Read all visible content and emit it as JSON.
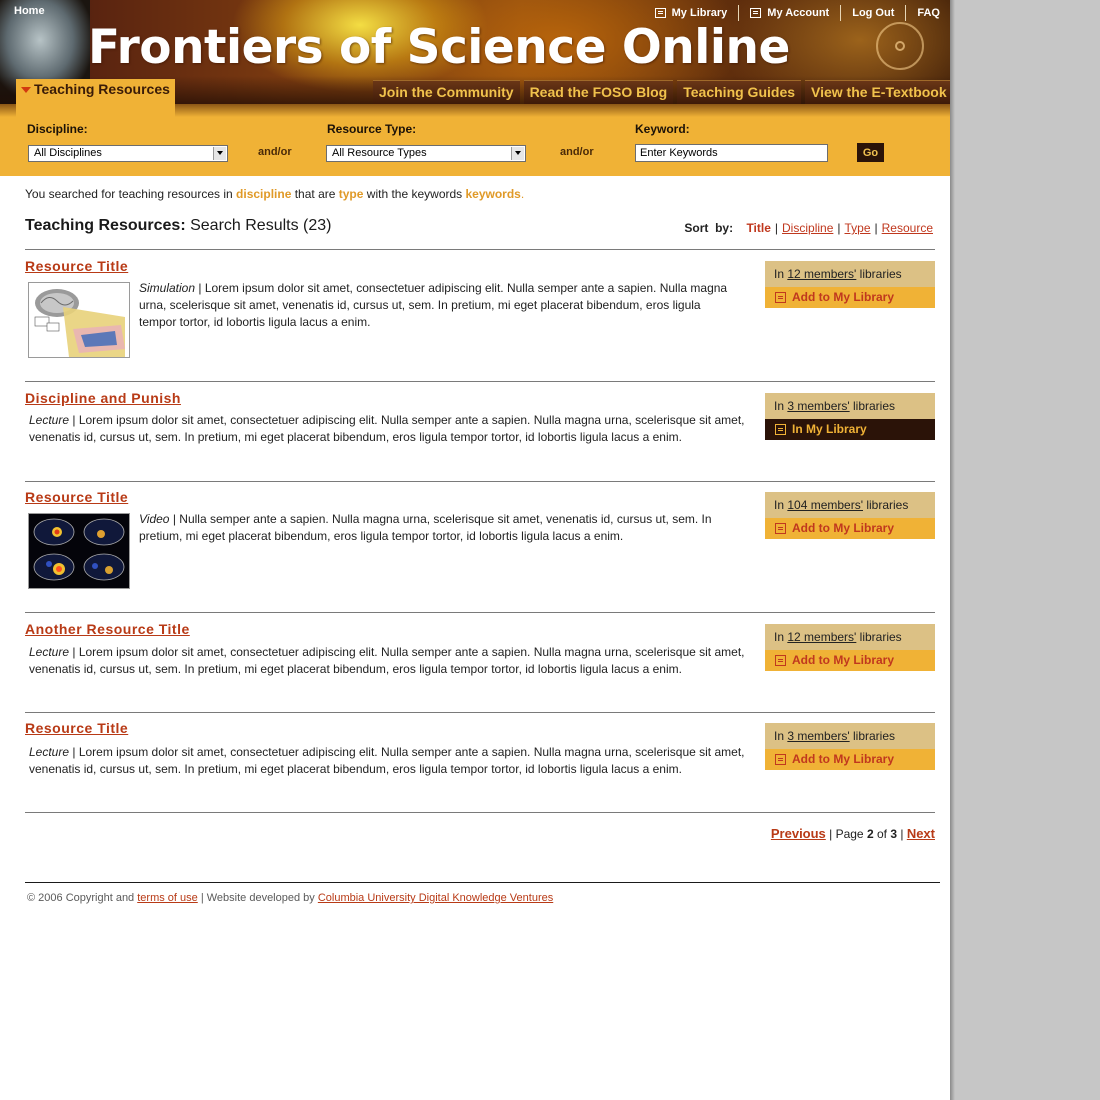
{
  "colors": {
    "accent_gold": "#f0b236",
    "link_red": "#b83a16",
    "dark_brown": "#2b1308",
    "library_box": "#dcc185"
  },
  "header": {
    "home_label": "Home",
    "site_title": "Frontiers of Science Online",
    "top_links": [
      {
        "label": "My Library",
        "icon": "library-icon"
      },
      {
        "label": "My Account",
        "icon": "account-icon"
      },
      {
        "label": "Log Out"
      },
      {
        "label": "FAQ"
      }
    ],
    "active_tab": "Teaching Resources",
    "tabs": [
      "Join the Community",
      "Read the FOSO Blog",
      "Teaching Guides",
      "View the E-Textbook"
    ]
  },
  "search": {
    "discipline_label": "Discipline:",
    "discipline_value": "All Disciplines",
    "andor_1": "and/or",
    "type_label": "Resource Type:",
    "type_value": "All Resource Types",
    "andor_2": "and/or",
    "keyword_label": "Keyword:",
    "keyword_value": "Enter Keywords",
    "go_label": "Go"
  },
  "summary": {
    "prefix": "You searched for teaching resources in ",
    "discipline": "discipline",
    "middle": " that are ",
    "type": "type",
    "middle2": " with the keywords ",
    "keywords": "keywords",
    "suffix": "."
  },
  "results_heading": {
    "label": "Teaching Resources:",
    "text": "Search Results (23)"
  },
  "sort": {
    "label": "Sort  by:",
    "options": [
      "Title",
      "Discipline",
      "Type",
      "Resource"
    ]
  },
  "results": [
    {
      "title": "Resource Title",
      "type": "Simulation",
      "desc": "Lorem ipsum dolor sit amet, consectetuer adipiscing elit. Nulla semper ante a sapien. Nulla magna urna, scelerisque sit amet, venenatis id, cursus ut, sem. In pretium, mi eget placerat bibendum, eros ligula tempor tortor, id lobortis ligula lacus a enim.",
      "thumbnail": "brain-simulation-thumbnail",
      "members_prefix": "In ",
      "members_link": "12 members'",
      "members_suffix": " libraries",
      "action": "Add to My Library"
    },
    {
      "title": "Discipline and Punish",
      "type": "Lecture",
      "desc": "Lorem ipsum dolor sit amet, consectetuer adipiscing elit. Nulla semper ante a sapien. Nulla magna urna, scelerisque sit amet, venenatis id, cursus ut, sem. In pretium, mi eget placerat bibendum, eros ligula tempor tortor, id lobortis ligula lacus a enim.",
      "members_prefix": "In ",
      "members_link": "3 members'",
      "members_suffix": " libraries",
      "action": "In My Library"
    },
    {
      "title": "Resource Title",
      "type": "Video",
      "desc": "Nulla semper ante a sapien. Nulla magna urna, scelerisque sit amet, venenatis id, cursus ut, sem. In pretium, mi eget placerat bibendum, eros ligula tempor tortor, id lobortis ligula lacus a enim.",
      "thumbnail": "brain-scans-thumbnail",
      "members_prefix": "In ",
      "members_link": "104 members'",
      "members_suffix": " libraries",
      "action": "Add to My Library"
    },
    {
      "title": "Another Resource Title",
      "type": "Lecture",
      "desc": "Lorem ipsum dolor sit amet, consectetuer adipiscing elit. Nulla semper ante a sapien. Nulla magna urna, scelerisque sit amet, venenatis id, cursus ut, sem. In pretium, mi eget placerat bibendum, eros ligula tempor tortor, id lobortis ligula lacus a enim.",
      "members_prefix": "In ",
      "members_link": "12 members'",
      "members_suffix": " libraries",
      "action": "Add to My Library"
    },
    {
      "title": "Resource Title",
      "type": "Lecture",
      "desc": "Lorem ipsum dolor sit amet, consectetuer adipiscing elit. Nulla semper ante a sapien. Nulla magna urna, scelerisque sit amet, venenatis id, cursus ut, sem. In pretium, mi eget placerat bibendum, eros ligula tempor tortor, id lobortis ligula lacus a enim.",
      "members_prefix": "In ",
      "members_link": "3 members'",
      "members_suffix": " libraries",
      "action": "Add to My Library"
    }
  ],
  "pagination": {
    "previous": "Previous",
    "page_label": " | Page ",
    "current": "2",
    "of": " of ",
    "total": "3",
    "sep": " | ",
    "next": "Next"
  },
  "footer": {
    "copyright": "© 2006 Copyright and ",
    "terms": "terms of use",
    "middle": " | Website developed by ",
    "developer": "Columbia University Digital Knowledge Ventures"
  }
}
